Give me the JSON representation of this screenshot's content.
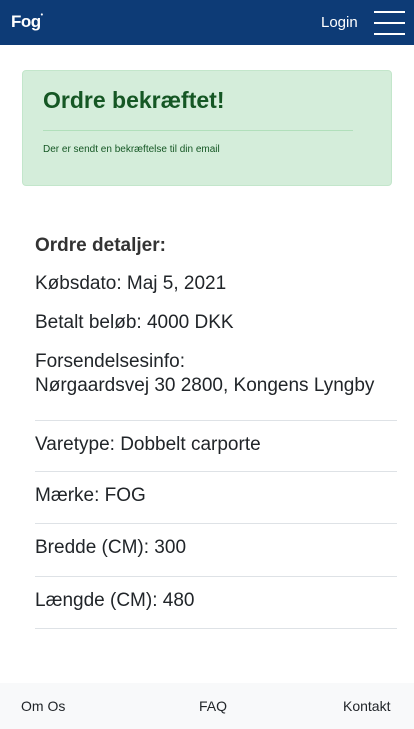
{
  "navbar": {
    "logo": "Fog",
    "login_label": "Login"
  },
  "alert": {
    "heading": "Ordre bekræftet!",
    "message": "Der er sendt en bekræftelse til din email"
  },
  "details": {
    "title": "Ordre detaljer:",
    "purchase_date": "Købsdato: Maj 5, 2021",
    "amount_paid": "Betalt beløb: 4000 DKK",
    "shipping_label": "Forsendelsesinfo:",
    "shipping_address": "Nørgaardsvej 30 2800, Kongens Lyngby"
  },
  "items": [
    {
      "text": "Varetype: Dobbelt carporte"
    },
    {
      "text": "Mærke: FOG"
    },
    {
      "text": "Bredde (CM): 300"
    },
    {
      "text": "Længde (CM): 480"
    }
  ],
  "footer": {
    "about": "Om Os",
    "faq": "FAQ",
    "contact": "Kontakt"
  },
  "colors": {
    "navbar": "#0d3b76",
    "success_bg": "#d4edda",
    "success_text": "#155724"
  }
}
